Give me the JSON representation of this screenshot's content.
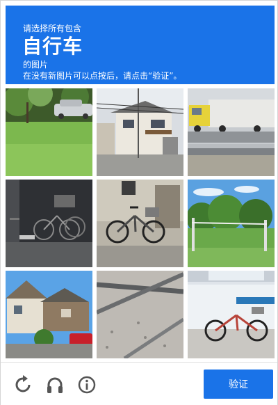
{
  "header": {
    "line1": "请选择所有包含",
    "keyword": "自行车",
    "line3": "的图片",
    "line4": "在没有新图片可以点按后，请点击“验证”。"
  },
  "tiles": [
    {
      "row": 1,
      "col": 1,
      "scene": "green lawn with trees and parked car"
    },
    {
      "row": 1,
      "col": 2,
      "scene": "two-storey house with utility poles"
    },
    {
      "row": 1,
      "col": 3,
      "scene": "truck on highway behind guardrail"
    },
    {
      "row": 2,
      "col": 1,
      "scene": "bicycles parked in dark garage"
    },
    {
      "row": 2,
      "col": 2,
      "scene": "bicycle parked in front of house"
    },
    {
      "row": 2,
      "col": 3,
      "scene": "fence and trees under blue sky"
    },
    {
      "row": 3,
      "col": 1,
      "scene": "houses with red car and shrub"
    },
    {
      "row": 3,
      "col": 2,
      "scene": "pipes on gravel ground"
    },
    {
      "row": 3,
      "col": 3,
      "scene": "bicycle in front of shop window"
    }
  ],
  "footer": {
    "reload_icon": "reload-icon",
    "audio_icon": "headphones-icon",
    "info_icon": "info-icon",
    "verify_label": "验证"
  },
  "colors": {
    "accent": "#1a73e8",
    "icon": "#555555",
    "border": "#dfdfdf"
  }
}
